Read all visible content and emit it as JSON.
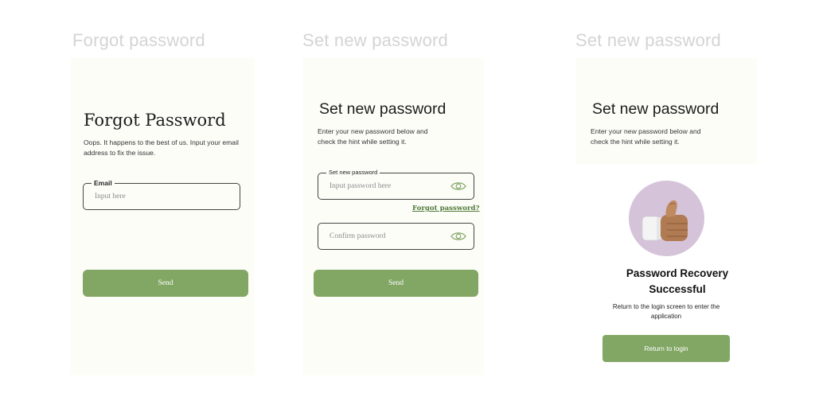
{
  "frames": {
    "forgot": {
      "frame_label": "Forgot password",
      "title": "Forgot Password",
      "description": "Oops. It happens to the best of us. Input your email address to fix the issue.",
      "email": {
        "label": "Email",
        "placeholder": "Input here",
        "value": ""
      },
      "send_label": "Send"
    },
    "set_new": {
      "frame_label": "Set new password",
      "title": "Set new password",
      "description": "Enter your new password below and check the hint while setting it.",
      "password": {
        "label": "Set new password",
        "placeholder": "Input password here",
        "value": ""
      },
      "forgot_link": "Forgot password?",
      "confirm": {
        "placeholder": "Confirm password",
        "value": ""
      },
      "send_label": "Send"
    },
    "success": {
      "frame_label": "Set new password",
      "title": "Set new password",
      "description": "Enter your new password below and check the hint while setting it.",
      "success_title": "Password Recovery Successful",
      "success_description": "Return to the login screen to enter the application",
      "return_label": "Return to login"
    }
  },
  "icons": {
    "password_visibility": "eye-icon",
    "success_badge": "thumbs-up-icon"
  },
  "colors": {
    "accent": "#82a664",
    "link": "#4f7a39",
    "panel_bg": "#fdfdf8",
    "frame_label": "#d4d4d4",
    "badge_bg": "#d5c3da"
  }
}
